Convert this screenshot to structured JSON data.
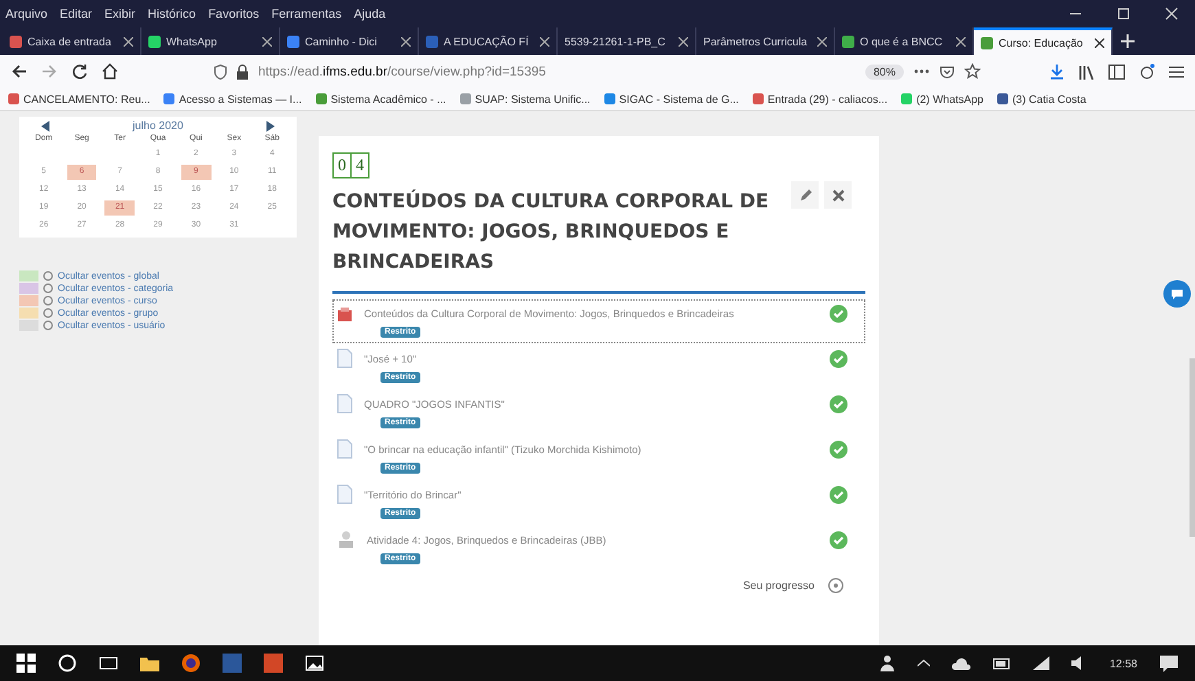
{
  "menu": [
    "Arquivo",
    "Editar",
    "Exibir",
    "Histórico",
    "Favoritos",
    "Ferramentas",
    "Ajuda"
  ],
  "tabs": [
    {
      "label": "Caixa de entrada",
      "selected": false,
      "color": "#d9534f"
    },
    {
      "label": "WhatsApp",
      "selected": false,
      "color": "#25d366"
    },
    {
      "label": "Caminho - Dici",
      "selected": false,
      "color": "#3b82f6"
    },
    {
      "label": "A EDUCAÇÃO FÍ",
      "selected": false,
      "color": "#2b5fb8"
    },
    {
      "label": "5539-21261-1-PB_C",
      "selected": false
    },
    {
      "label": "Parâmetros Curricula",
      "selected": false
    },
    {
      "label": "O que é a BNCC",
      "selected": false,
      "color": "#3fae49"
    },
    {
      "label": "Curso: Educação",
      "selected": true,
      "color": "#4a9d3a"
    }
  ],
  "url": "https://ead.**ifms.edu.br**/course/view.php?id=15395",
  "zoom": "80%",
  "bookmarks": [
    {
      "label": "CANCELAMENTO: Reu...",
      "color": "#d9534f"
    },
    {
      "label": "Acesso a Sistemas — I...",
      "color": "#3b82f6"
    },
    {
      "label": "Sistema Acadêmico - ...",
      "color": "#4a9d3a"
    },
    {
      "label": "SUAP: Sistema Unific...",
      "color": "#9aa0a6"
    },
    {
      "label": "SIGAC - Sistema de G...",
      "color": "#1e88e5"
    },
    {
      "label": "Entrada (29) - caliacos...",
      "color": "#d9534f"
    },
    {
      "label": "(2) WhatsApp",
      "color": "#25d366"
    },
    {
      "label": "(3) Catia Costa",
      "color": "#3b5998"
    }
  ],
  "calendar": {
    "month": "julho 2020",
    "weekdays": [
      "Dom",
      "Seg",
      "Ter",
      "Qua",
      "Qui",
      "Sex",
      "Sáb"
    ],
    "weeks": [
      {
        "kind": "first",
        "days": [
          {
            "d": "1",
            "event": false
          },
          {
            "d": "2",
            "event": false
          },
          {
            "d": "3",
            "event": false
          },
          {
            "d": "4",
            "event": false
          }
        ]
      },
      {
        "kind": "week",
        "days": [
          {
            "d": "5",
            "event": false
          },
          {
            "d": "6",
            "event": true
          },
          {
            "d": "7",
            "event": false
          },
          {
            "d": "8",
            "event": false
          },
          {
            "d": "9",
            "event": true
          },
          {
            "d": "10",
            "event": false
          },
          {
            "d": "11",
            "event": false
          }
        ]
      },
      {
        "kind": "week",
        "days": [
          {
            "d": "12",
            "event": false
          },
          {
            "d": "13",
            "event": false
          },
          {
            "d": "14",
            "event": false
          },
          {
            "d": "15",
            "event": false
          },
          {
            "d": "16",
            "event": false
          },
          {
            "d": "17",
            "event": false
          },
          {
            "d": "18",
            "event": false
          }
        ]
      },
      {
        "kind": "week",
        "days": [
          {
            "d": "19",
            "event": false
          },
          {
            "d": "20",
            "event": false
          },
          {
            "d": "21",
            "event": true
          },
          {
            "d": "22",
            "event": false
          },
          {
            "d": "23",
            "event": false
          },
          {
            "d": "24",
            "event": false
          },
          {
            "d": "25",
            "event": false
          }
        ]
      },
      {
        "kind": "week",
        "days": [
          {
            "d": "26",
            "event": false
          },
          {
            "d": "27",
            "event": false
          },
          {
            "d": "28",
            "event": false
          },
          {
            "d": "29",
            "event": false
          },
          {
            "d": "30",
            "event": false
          },
          {
            "d": "31",
            "event": false
          }
        ]
      }
    ]
  },
  "event_filters": [
    {
      "label": "Ocultar eventos - global",
      "color": "#c9e7c0"
    },
    {
      "label": "Ocultar eventos - categoria",
      "color": "#d9c5e6"
    },
    {
      "label": "Ocultar eventos - curso",
      "color": "#f3c7b4"
    },
    {
      "label": "Ocultar eventos - grupo",
      "color": "#f5deb0"
    },
    {
      "label": "Ocultar eventos - usuário",
      "color": "#dcdcdc"
    }
  ],
  "section": {
    "number": [
      "0",
      "4"
    ],
    "title": "CONTEÚDOS DA CULTURA CORPORAL DE MOVIMENTO: JOGOS, BRINQUEDOS E BRINCADEIRAS",
    "activities": [
      {
        "kind": "package",
        "name": "Conteúdos da Cultura Corporal de Movimento: Jogos, Brinquedos e Brincadeiras",
        "badge": "Restrito",
        "completed": true,
        "highlighted": true
      },
      {
        "kind": "page",
        "name": "\"José + 10\"",
        "badge": "Restrito",
        "completed": true,
        "highlighted": false
      },
      {
        "kind": "page",
        "name": "QUADRO \"JOGOS INFANTIS\"",
        "badge": "Restrito",
        "completed": true,
        "highlighted": false
      },
      {
        "kind": "page",
        "name": "\"O brincar na educação infantil\" (Tizuko Morchida Kishimoto)",
        "badge": "Restrito",
        "completed": true,
        "highlighted": false
      },
      {
        "kind": "page",
        "name": "\"Território do Brincar\"",
        "badge": "Restrito",
        "completed": true,
        "highlighted": false
      },
      {
        "kind": "assignment",
        "name": "Atividade 4: Jogos, Brinquedos e Brincadeiras (JBB)",
        "badge": "Restrito",
        "completed": true,
        "highlighted": false
      }
    ],
    "progress_label": "Seu progresso"
  },
  "clock": "12:58"
}
